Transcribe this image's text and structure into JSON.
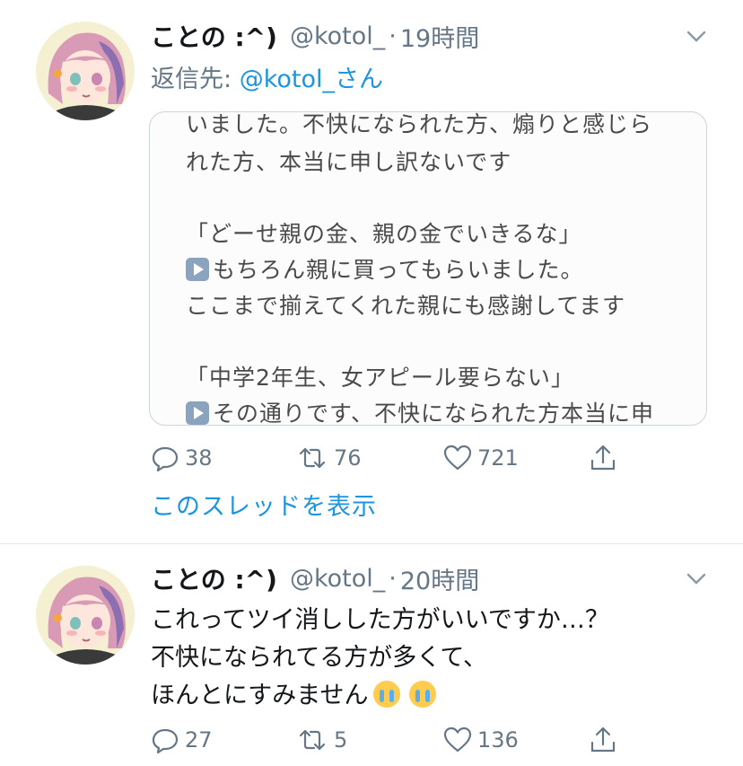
{
  "tweets": [
    {
      "name": "ことの :^)",
      "handle": "@kotol_",
      "separator": "·",
      "time": "19時間",
      "reply_prefix": "返信先:",
      "reply_mention": "@kotol_さん",
      "media_lines": [
        "いました。不快になられた方、煽りと感じら",
        "れた方、本当に申し訳ないです",
        "「どーせ親の金、親の金でいきるな」",
        "もちろん親に買ってもらいました。",
        "ここまで揃えてくれた親にも感謝してます",
        "「中学2年生、女アピール要らない」",
        "その通りです、不快になられた方本当に申"
      ],
      "replies": "38",
      "retweets": "76",
      "likes": "721",
      "thread_link": "このスレッドを表示"
    },
    {
      "name": "ことの :^)",
      "handle": "@kotol_",
      "separator": "·",
      "time": "20時間",
      "text_lines": [
        "これってツイ消しした方がいいですか…？",
        "不快になられてる方が多くて、",
        "ほんとにすみません"
      ],
      "emojis": [
        "loudly-crying-face-emoji",
        "loudly-crying-face-emoji"
      ],
      "replies": "27",
      "retweets": "5",
      "likes": "136"
    }
  ],
  "colors": {
    "link": "#1b95e0",
    "secondary": "#657786",
    "divider": "#e1e8ed",
    "text": "#14171a"
  }
}
